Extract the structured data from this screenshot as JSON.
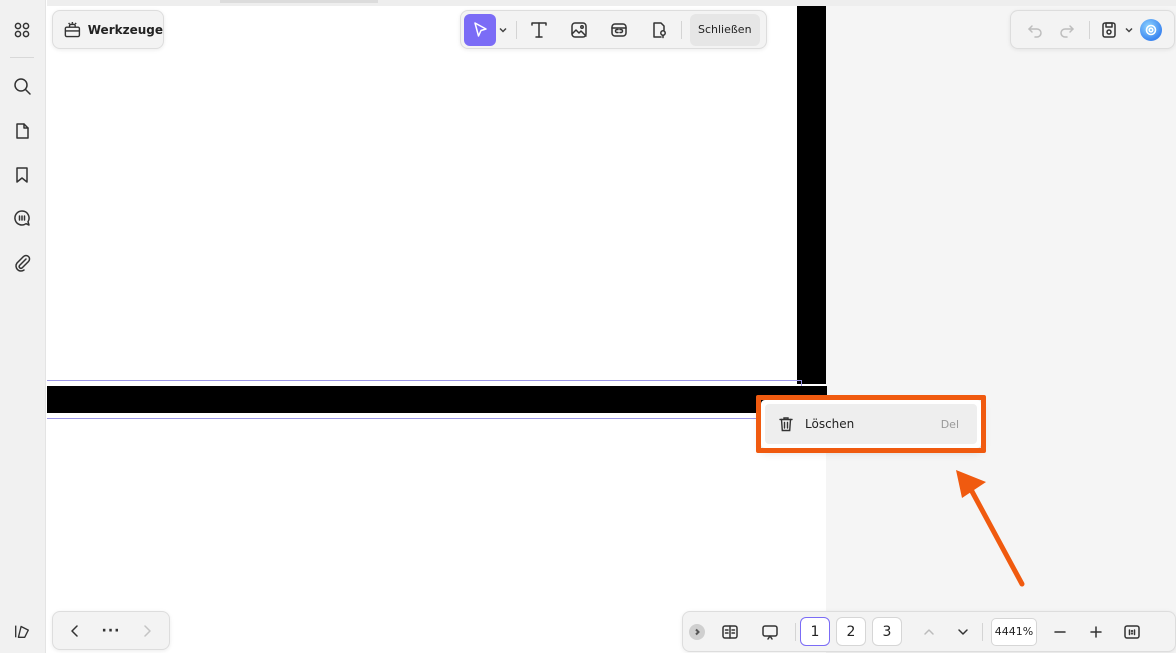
{
  "toolbar": {
    "tools_label": "Werkzeuge",
    "close_edit_label": "Schließen"
  },
  "context_menu": {
    "items": [
      {
        "label": "Löschen",
        "shortcut": "Del",
        "icon": "trash-icon"
      }
    ]
  },
  "bottom_bar": {
    "pages": [
      "1",
      "2",
      "3"
    ],
    "current_page": "1",
    "zoom": "4441%",
    "more_label": "···"
  },
  "icons": {
    "left_rail": [
      "apps-icon",
      "search-icon",
      "pages-icon",
      "bookmark-icon",
      "comments-icon",
      "attachment-icon"
    ],
    "bottom_left": "sidebar-toggle-icon",
    "edit_tools": [
      "select-pointer-icon",
      "text-icon",
      "image-icon",
      "link-icon",
      "watermark-icon"
    ],
    "right_tools": [
      "undo-icon",
      "redo-icon",
      "save-icon",
      "ai-assistant-icon"
    ]
  },
  "colors": {
    "accent": "#7b6cf6",
    "annotation": "#f05a0f",
    "selection_line": "#9b95e6"
  }
}
